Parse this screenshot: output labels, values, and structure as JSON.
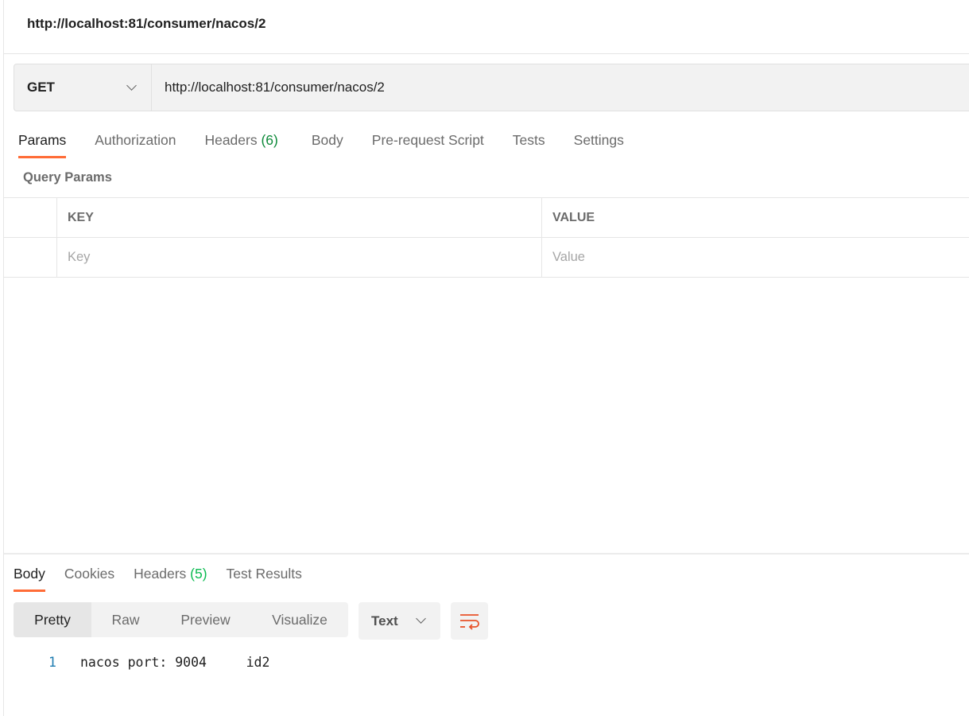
{
  "title": "http://localhost:81/consumer/nacos/2",
  "request": {
    "method": "GET",
    "url": "http://localhost:81/consumer/nacos/2",
    "tabs": [
      {
        "label": "Params",
        "active": true
      },
      {
        "label": "Authorization"
      },
      {
        "label": "Headers",
        "count": "(6)"
      },
      {
        "label": "Body"
      },
      {
        "label": "Pre-request Script"
      },
      {
        "label": "Tests"
      },
      {
        "label": "Settings"
      }
    ],
    "query_params_title": "Query Params",
    "table": {
      "headers": [
        "KEY",
        "VALUE"
      ],
      "placeholders": {
        "key": "Key",
        "value": "Value"
      }
    }
  },
  "response": {
    "tabs": [
      {
        "label": "Body",
        "active": true
      },
      {
        "label": "Cookies"
      },
      {
        "label": "Headers",
        "count": "(5)"
      },
      {
        "label": "Test Results"
      }
    ],
    "view_modes": [
      "Pretty",
      "Raw",
      "Preview",
      "Visualize"
    ],
    "active_view": "Pretty",
    "format": "Text",
    "wrap_icon": "wrap-lines-icon",
    "lines": [
      {
        "number": "1",
        "text": "nacos port: 9004     id2"
      }
    ]
  },
  "colors": {
    "accent": "#ff6c37",
    "line_number": "#1d7bb0"
  }
}
